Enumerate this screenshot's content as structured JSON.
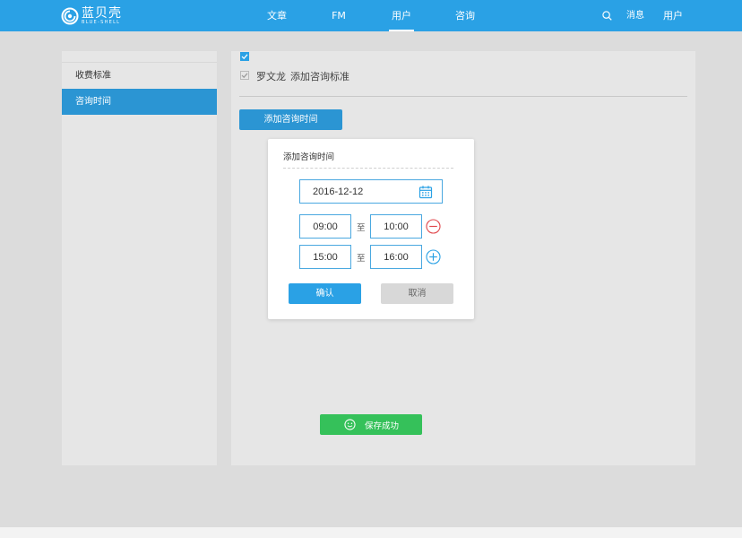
{
  "brand": {
    "name_cn": "蓝贝壳",
    "name_en": "BLUE-SHELL"
  },
  "nav": {
    "items": [
      "文章",
      "FM",
      "用户",
      "咨询"
    ],
    "active_index": 2
  },
  "header_right": {
    "search_icon": "search-icon",
    "messages": "消息",
    "user": "用户"
  },
  "sidebar": {
    "items": [
      "收费标准",
      "咨询时间"
    ],
    "active_index": 1
  },
  "content": {
    "row_name": "罗文龙",
    "row_action": "添加咨询标准",
    "add_button": "添加咨询时间"
  },
  "dialog": {
    "title": "添加咨询时间",
    "date": "2016-12-12",
    "date_icon": "calendar-icon",
    "slots": [
      {
        "start": "09:00",
        "to": "至",
        "end": "10:00",
        "action_icon": "remove-circle-icon"
      },
      {
        "start": "15:00",
        "to": "至",
        "end": "16:00",
        "action_icon": "add-circle-icon"
      }
    ],
    "confirm": "确认",
    "cancel": "取消"
  },
  "toast": {
    "text": "保存成功",
    "icon": "smile-icon"
  },
  "colors": {
    "primary": "#2aa1e5",
    "sidebar_active": "#2b95d3",
    "success": "#35c15a",
    "danger": "#e0474c",
    "background": "#dcdcdc",
    "panel": "#e6e6e6"
  }
}
